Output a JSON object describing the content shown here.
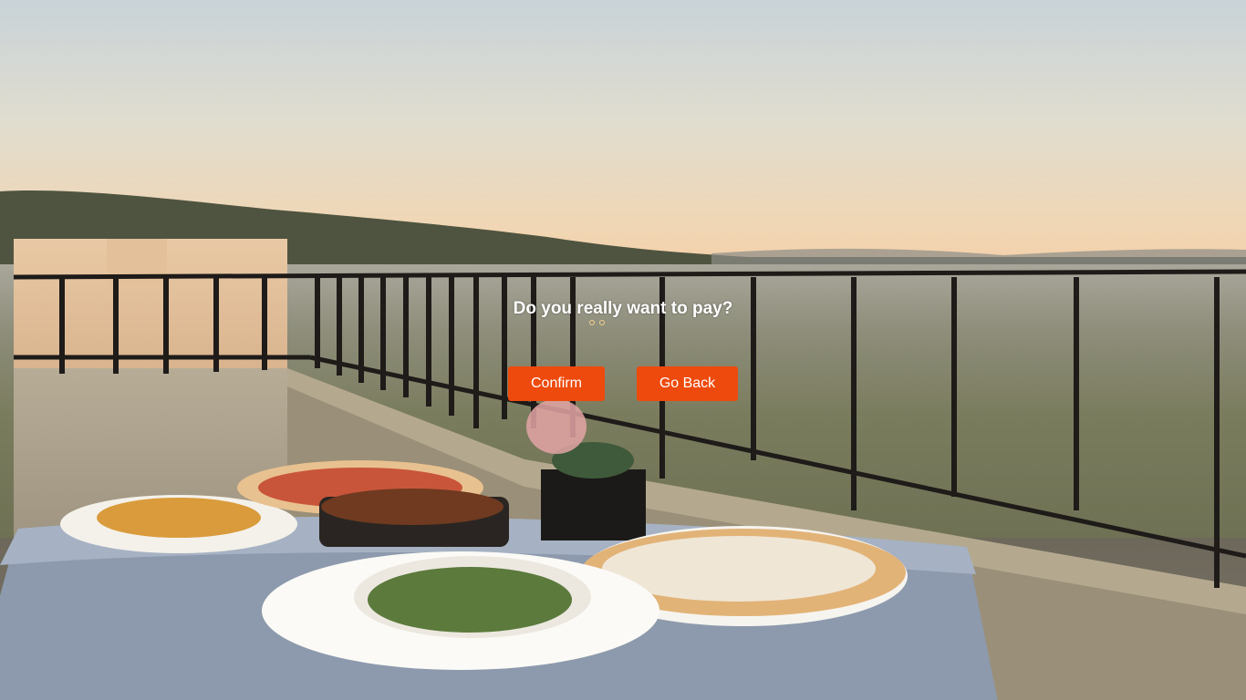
{
  "dialog": {
    "title": "Do you really want to pay?",
    "confirm_label": "Confirm",
    "back_label": "Go Back"
  },
  "colors": {
    "button_bg": "#ee4a0d",
    "button_text": "#ffffff",
    "title_text": "#ffffff"
  }
}
